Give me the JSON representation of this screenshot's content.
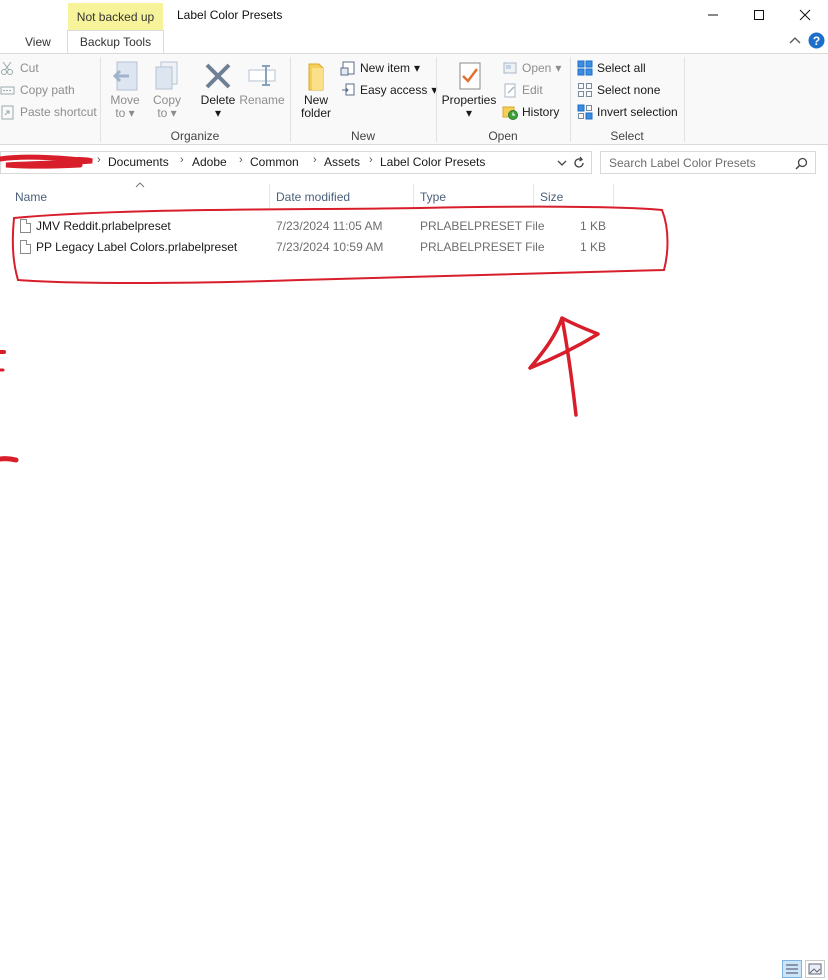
{
  "window": {
    "title": "Label Color Presets",
    "context_tab": "Not backed up"
  },
  "tabs": {
    "view": "View",
    "backup_tools": "Backup Tools"
  },
  "ribbon": {
    "clipboard": {
      "cut": "Cut",
      "copy_path": "Copy path",
      "paste_shortcut": "Paste shortcut"
    },
    "organize": {
      "label": "Organize",
      "move_to": [
        "Move",
        "to"
      ],
      "copy_to": [
        "Copy",
        "to"
      ],
      "delete": "Delete",
      "rename": "Rename"
    },
    "new": {
      "label": "New",
      "new_folder": [
        "New",
        "folder"
      ],
      "new_item": "New item",
      "easy_access": "Easy access"
    },
    "open": {
      "label": "Open",
      "properties": "Properties",
      "open": "Open",
      "edit": "Edit",
      "history": "History"
    },
    "select": {
      "label": "Select",
      "select_all": "Select all",
      "select_none": "Select none",
      "invert_selection": "Invert selection"
    }
  },
  "address": {
    "crumbs": [
      "Documents",
      "Adobe",
      "Common",
      "Assets",
      "Label Color Presets"
    ],
    "search_placeholder": "Search Label Color Presets"
  },
  "columns": {
    "name": "Name",
    "date": "Date modified",
    "type": "Type",
    "size": "Size"
  },
  "files": [
    {
      "name": "JMV Reddit.prlabelpreset",
      "date": "7/23/2024 11:05 AM",
      "type": "PRLABELPRESET File",
      "size": "1 KB"
    },
    {
      "name": "PP Legacy Label Colors.prlabelpreset",
      "date": "7/23/2024 10:59 AM",
      "type": "PRLABELPRESET File",
      "size": "1 KB"
    }
  ],
  "annotation": {
    "mark": "4",
    "color": "#d81e2a"
  },
  "colors": {
    "context_tab": "#f7f39b",
    "accent": "#1e6fc9",
    "header_text": "#4c607a"
  }
}
